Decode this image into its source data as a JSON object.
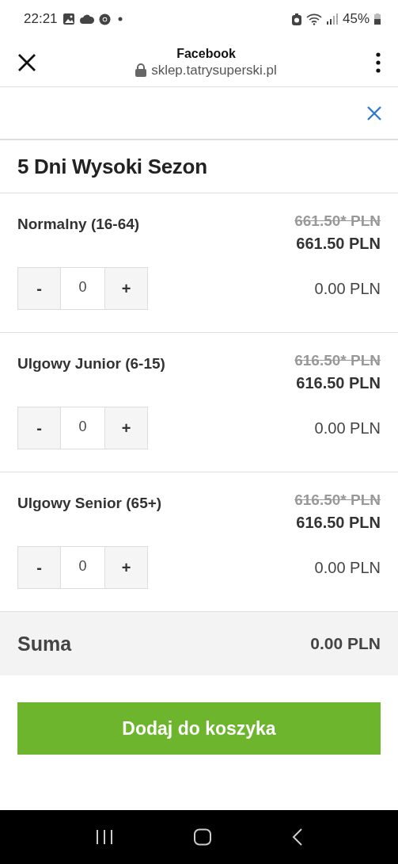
{
  "status_bar": {
    "time": "22:21",
    "battery": "45%"
  },
  "browser": {
    "title": "Facebook",
    "url": "sklep.tatrysuperski.pl"
  },
  "product": {
    "title": "5 Dni Wysoki Sezon"
  },
  "tickets": [
    {
      "name": "Normalny (16-64)",
      "old_price": "661.50* PLN",
      "price": "661.50 PLN",
      "minus": "-",
      "quantity": "0",
      "plus": "+",
      "subtotal": "0.00 PLN"
    },
    {
      "name": "Ulgowy Junior (6-15)",
      "old_price": "616.50* PLN",
      "price": "616.50 PLN",
      "minus": "-",
      "quantity": "0",
      "plus": "+",
      "subtotal": "0.00 PLN"
    },
    {
      "name": "Ulgowy Senior (65+)",
      "old_price": "616.50* PLN",
      "price": "616.50 PLN",
      "minus": "-",
      "quantity": "0",
      "plus": "+",
      "subtotal": "0.00 PLN"
    }
  ],
  "summary": {
    "label": "Suma",
    "total": "0.00 PLN"
  },
  "add_button": "Dodaj do koszyka"
}
